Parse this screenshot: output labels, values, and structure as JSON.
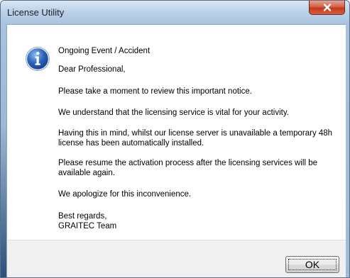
{
  "window": {
    "title": "License Utility"
  },
  "icons": {
    "message_icon": "information-icon",
    "close": "close-icon"
  },
  "message": {
    "heading": "Ongoing Event / Accident",
    "greeting": "Dear Professional,",
    "line1": "Please take a moment to review this important notice.",
    "line2": "We understand that the licensing service is vital for your activity.",
    "line3a": "Having this in mind, whilst our license server is unavailable a temporary 48h",
    "line3b": "license has been automatically installed.",
    "line4a": "Please resume the activation process after the licensing services will be",
    "line4b": "available again.",
    "line5": "We apologize for this inconvenience.",
    "closing": "Best regards,",
    "signature": "GRAITEC Team"
  },
  "buttons": {
    "ok_label": "OK"
  },
  "colors": {
    "close_button": "#c2391e",
    "info_icon": "#2a64b8",
    "footer_bg": "#f0f0f0"
  }
}
